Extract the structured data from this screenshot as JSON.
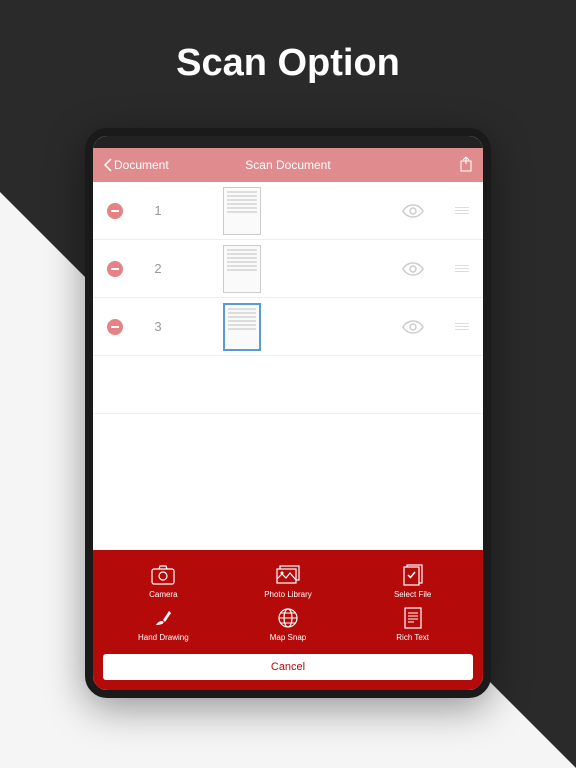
{
  "promo": {
    "title": "Scan Option"
  },
  "nav": {
    "back_label": "Document",
    "title": "Scan Document"
  },
  "documents": [
    {
      "index": "1",
      "selected": false
    },
    {
      "index": "2",
      "selected": false
    },
    {
      "index": "3",
      "selected": true
    }
  ],
  "actions": {
    "camera": "Camera",
    "photo_library": "Photo Library",
    "select_file": "Select File",
    "hand_drawing": "Hand Drawing",
    "map_snap": "Map Snap",
    "rich_text": "Rich Text",
    "cancel": "Cancel"
  }
}
